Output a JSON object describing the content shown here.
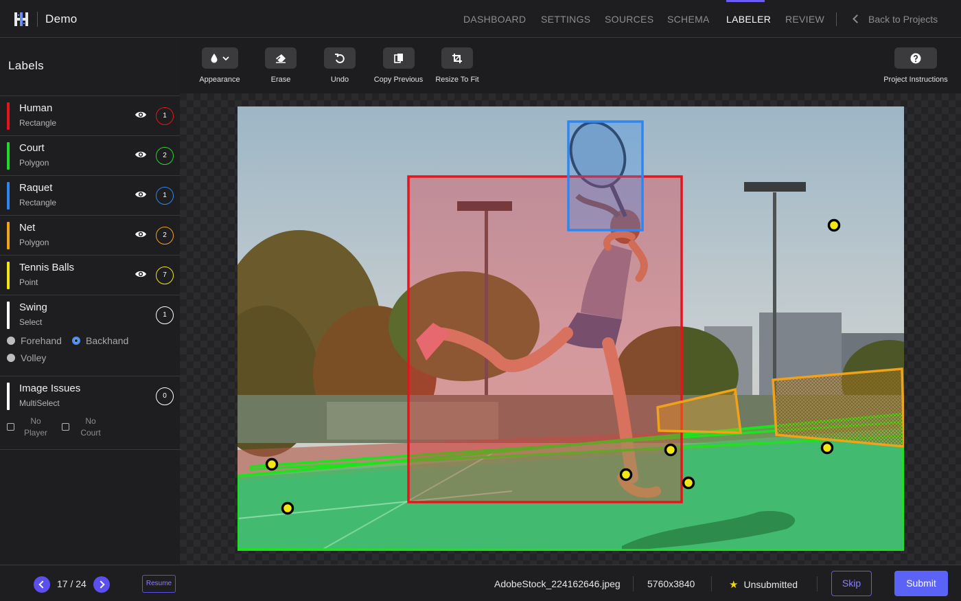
{
  "app": {
    "name": "Demo",
    "logo_icon": "grid-logo-icon"
  },
  "nav": {
    "items": [
      {
        "label": "DASHBOARD",
        "active": false
      },
      {
        "label": "SETTINGS",
        "active": false
      },
      {
        "label": "SOURCES",
        "active": false
      },
      {
        "label": "SCHEMA",
        "active": false
      },
      {
        "label": "LABELER",
        "active": true
      },
      {
        "label": "REVIEW",
        "active": false
      }
    ],
    "back_label": "Back to Projects",
    "accent_color": "#6a5cf4"
  },
  "sidebar": {
    "title": "Labels",
    "labels": [
      {
        "name": "Human",
        "type": "Rectangle",
        "count": "1",
        "color": "#e8141c",
        "visible": true
      },
      {
        "name": "Court",
        "type": "Polygon",
        "count": "2",
        "color": "#22d92a",
        "visible": true
      },
      {
        "name": "Raquet",
        "type": "Rectangle",
        "count": "1",
        "color": "#2f86f0",
        "visible": true
      },
      {
        "name": "Net",
        "type": "Polygon",
        "count": "2",
        "color": "#f0a21a",
        "visible": true
      },
      {
        "name": "Tennis Balls",
        "type": "Point",
        "count": "7",
        "color": "#f2e614",
        "visible": true
      }
    ],
    "swing": {
      "name": "Swing",
      "type": "Select",
      "count": "1",
      "color": "#ffffff",
      "options": [
        {
          "label": "Forehand",
          "selected": false
        },
        {
          "label": "Backhand",
          "selected": true
        },
        {
          "label": "Volley",
          "selected": false
        }
      ]
    },
    "issues": {
      "name": "Image Issues",
      "type": "MultiSelect",
      "count": "0",
      "color": "#ffffff",
      "options": [
        {
          "line1": "No",
          "line2": "Player",
          "checked": false
        },
        {
          "line1": "No",
          "line2": "Court",
          "checked": false
        }
      ]
    }
  },
  "toolbar": {
    "appearance": "Appearance",
    "erase": "Erase",
    "undo": "Undo",
    "copy_previous": "Copy Previous",
    "resize_to_fit": "Resize To Fit",
    "project_instructions": "Project Instructions"
  },
  "footer": {
    "pager": "17 / 24",
    "resume": "Resume",
    "file_name": "AdobeStock_224162646.jpeg",
    "dimensions": "5760x3840",
    "status": "Unsubmitted",
    "skip": "Skip",
    "submit": "Submit",
    "submit_color": "#5b63f6"
  }
}
